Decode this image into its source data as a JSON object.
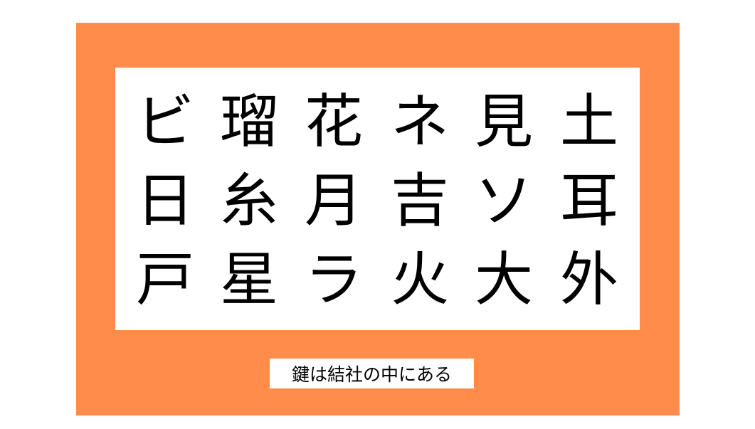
{
  "colors": {
    "background": "#ffffff",
    "panel": "#ff8c4a",
    "card": "#ffffff",
    "text": "#000000"
  },
  "grid": {
    "rows": [
      [
        "ビ",
        "瑠",
        "花",
        "ネ",
        "見",
        "土"
      ],
      [
        "日",
        "糸",
        "月",
        "吉",
        "ソ",
        "耳"
      ],
      [
        "戸",
        "星",
        "ラ",
        "火",
        "大",
        "外"
      ]
    ]
  },
  "hint": {
    "text": "鍵は結社の中にある"
  }
}
